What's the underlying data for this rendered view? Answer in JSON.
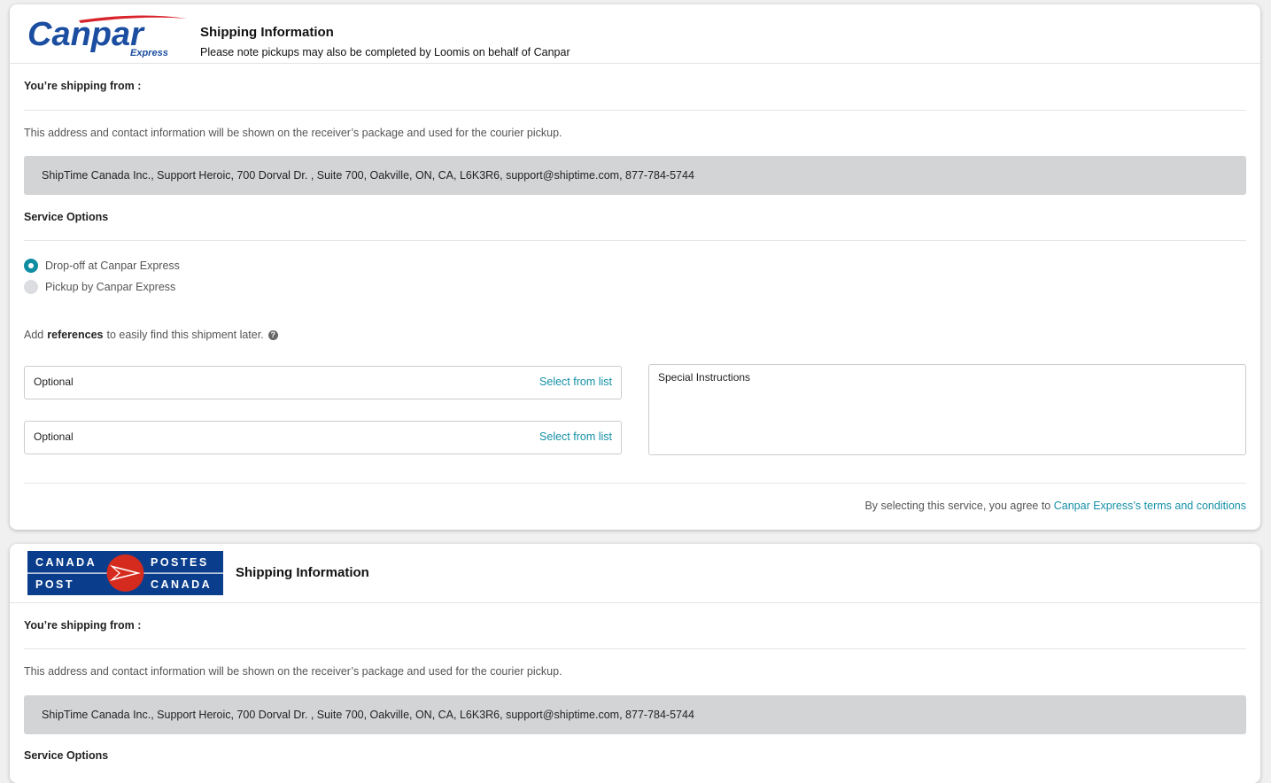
{
  "canpar": {
    "logo_text": "Canpar",
    "logo_sub": "Express",
    "title": "Shipping Information",
    "subtitle": "Please note pickups may also be completed by Loomis on behalf of Canpar",
    "shipping_from_label": "You’re shipping from :",
    "info_text": "This address and contact information will be shown on the receiver’s package and used for the courier pickup.",
    "address": "ShipTime Canada Inc., Support Heroic, 700 Dorval Dr. , Suite 700, Oakville, ON, CA, L6K3R6, support@shiptime.com, 877-784-5744",
    "service_options_label": "Service Options",
    "options": [
      {
        "label": "Drop-off at Canpar Express",
        "selected": true
      },
      {
        "label": "Pickup by Canpar Express",
        "selected": false
      }
    ],
    "references": {
      "prefix": "Add",
      "bold": "references",
      "suffix": "to easily find this shipment later."
    },
    "ref_inputs": [
      {
        "placeholder": "Optional",
        "select_label": "Select from list"
      },
      {
        "placeholder": "Optional",
        "select_label": "Select from list"
      }
    ],
    "special_instructions": "Special Instructions",
    "terms_prefix": "By selecting this service, you agree to",
    "terms_link": "Canpar Express’s terms and conditions"
  },
  "canadapost": {
    "logo_lines": [
      "CANADA",
      "POSTES",
      "POST",
      "CANADA"
    ],
    "title": "Shipping Information",
    "shipping_from_label": "You’re shipping from :",
    "info_text": "This address and contact information will be shown on the receiver’s package and used for the courier pickup.",
    "address": "ShipTime Canada Inc., Support Heroic, 700 Dorval Dr. , Suite 700, Oakville, ON, CA, L6K3R6, support@shiptime.com, 877-784-5744",
    "service_options_label": "Service Options"
  },
  "colors": {
    "accent": "#0f8ea3",
    "link": "#1490a6",
    "canpar_blue": "#1b4ea0",
    "canpar_red": "#d8232a",
    "cp_blue": "#0a3e8c",
    "cp_red": "#d52b1e"
  }
}
